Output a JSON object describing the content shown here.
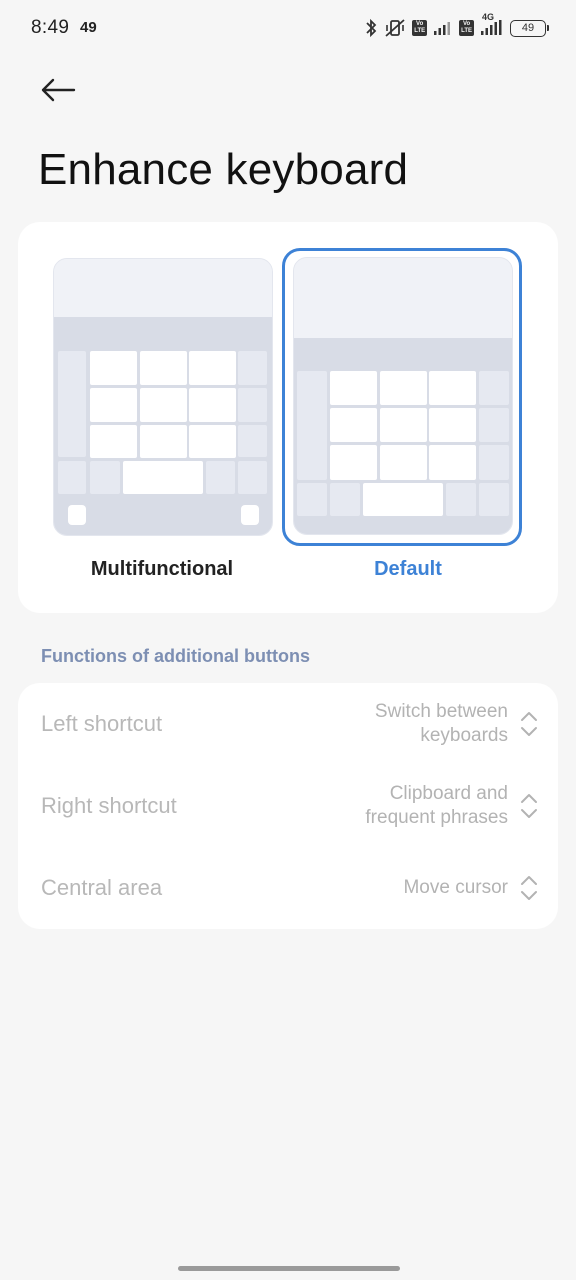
{
  "status_bar": {
    "time": "8:49",
    "extra": "49",
    "battery": "49",
    "network_label": "4G",
    "volte_label": "Vo LTE"
  },
  "header": {
    "title": "Enhance keyboard"
  },
  "layouts": [
    {
      "label": "Multifunctional",
      "selected": false
    },
    {
      "label": "Default",
      "selected": true
    }
  ],
  "section": {
    "title": "Functions of additional buttons"
  },
  "settings": [
    {
      "label": "Left shortcut",
      "value_line1": "Switch between",
      "value_line2": "keyboards"
    },
    {
      "label": "Right shortcut",
      "value_line1": "Clipboard and",
      "value_line2": "frequent phrases"
    },
    {
      "label": "Central area",
      "value_line1": "Move cursor",
      "value_line2": ""
    }
  ],
  "colors": {
    "accent": "#3d82d6",
    "section_header": "#7d8fb3",
    "background": "#f6f6f6"
  }
}
